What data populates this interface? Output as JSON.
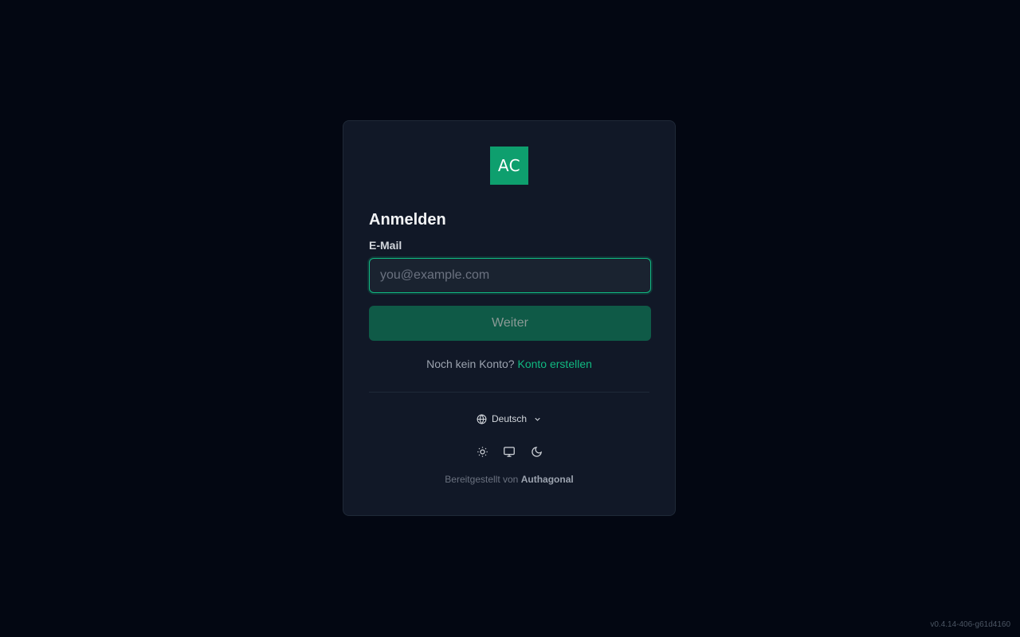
{
  "logo": {
    "text": "AC",
    "color": "#0e9f6e"
  },
  "login": {
    "title": "Anmelden",
    "email_label": "E-Mail",
    "email_value": "",
    "email_placeholder": "you@example.com",
    "submit_label": "Weiter",
    "signup_prompt": "Noch kein Konto?",
    "signup_link": "Konto erstellen"
  },
  "language": {
    "icon": "globe-icon",
    "selected": "Deutsch",
    "chevron": "chevron-down-icon"
  },
  "theme": {
    "options": [
      "sun-icon",
      "monitor-icon",
      "moon-icon"
    ]
  },
  "footer": {
    "prefix": "Bereitgestellt von",
    "brand": "Authagonal"
  },
  "version": "v0.4.14-406-g61d4160",
  "colors": {
    "background": "#030712",
    "card": "#111827",
    "accent": "#10b981",
    "button": "#0f5a47"
  }
}
